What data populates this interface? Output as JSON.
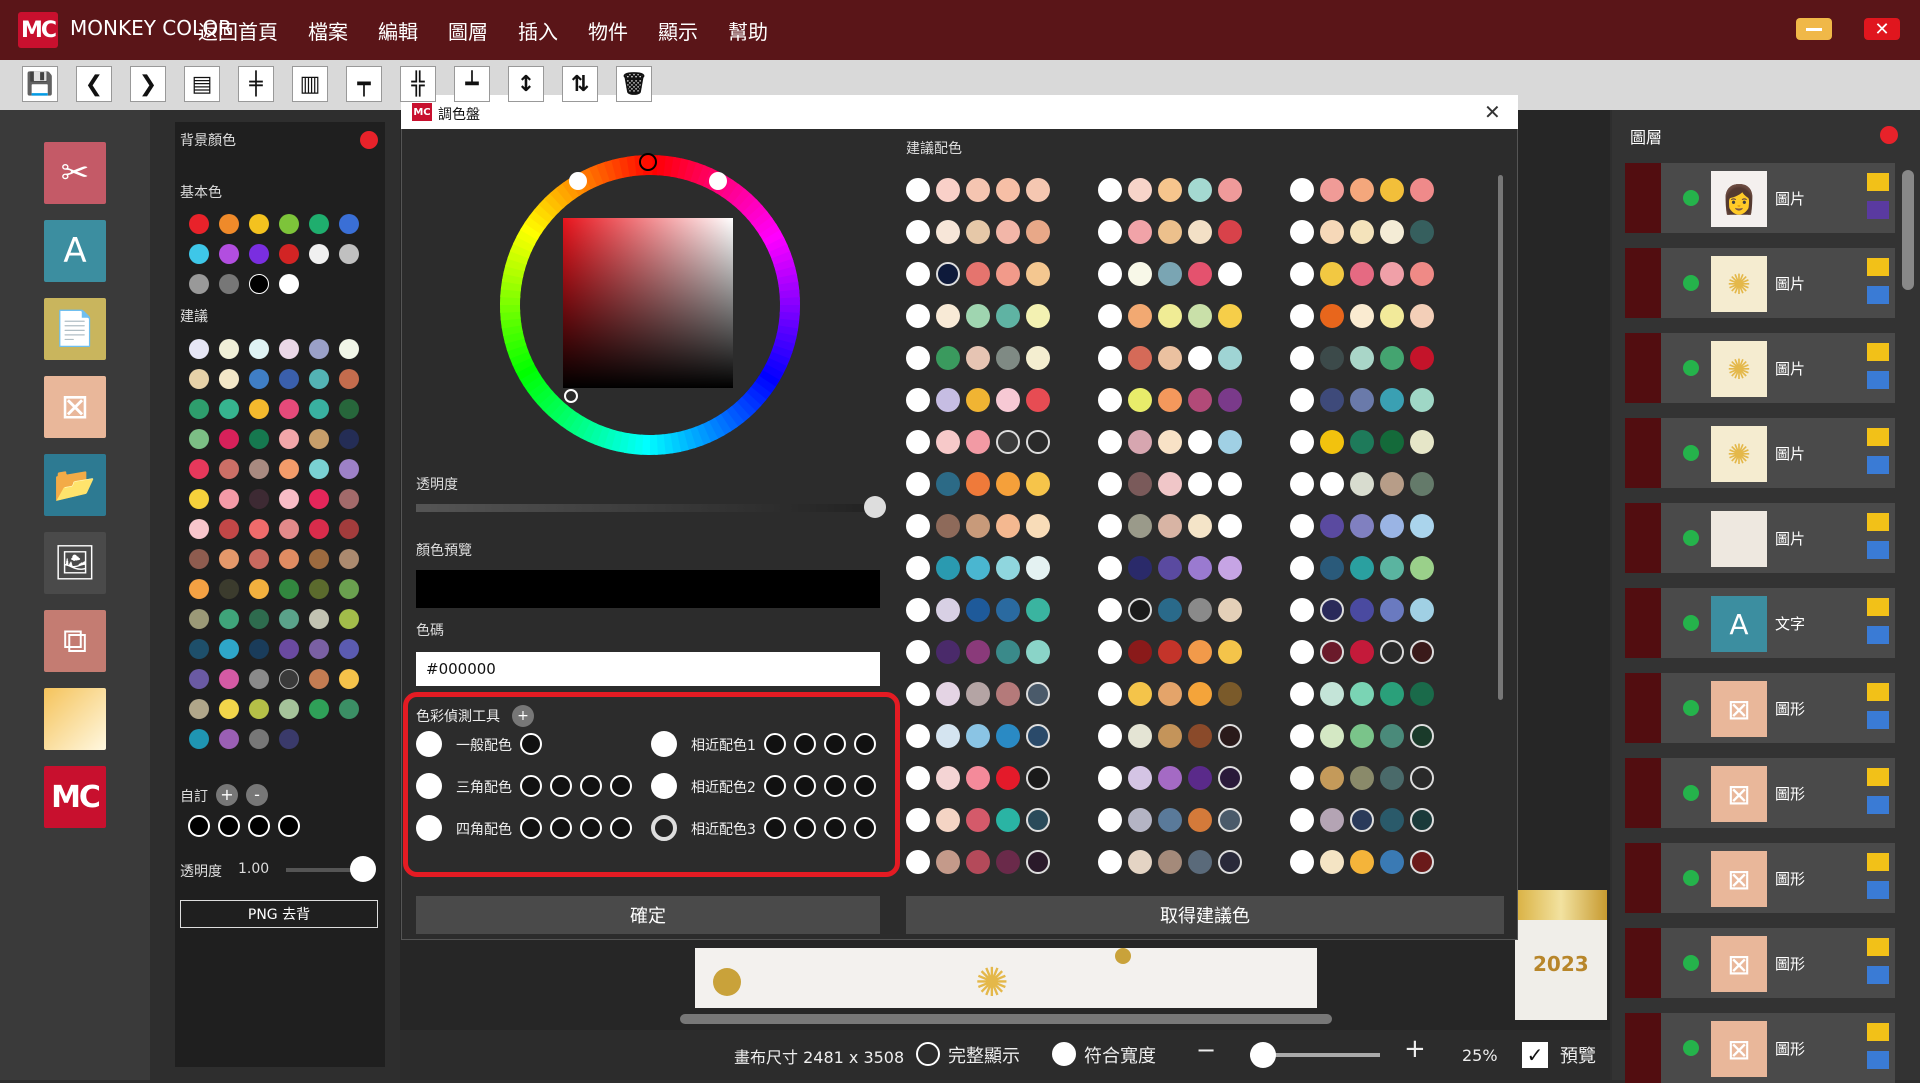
{
  "app": {
    "name": "MONKEY COLOR",
    "logo": "MC"
  },
  "menu": [
    "返回首頁",
    "檔案",
    "編輯",
    "圖層",
    "插入",
    "物件",
    "顯示",
    "幫助"
  ],
  "toolbar_icons": [
    "save-icon",
    "back-icon",
    "forward-icon",
    "align-left-icon",
    "align-center-icon",
    "align-right-icon",
    "align-top-icon",
    "align-middle-icon",
    "align-bottom-icon",
    "distribute-icon",
    "flip-icon",
    "trash-icon"
  ],
  "toolbar_glyphs": [
    "💾",
    "❮",
    "❯",
    "▤",
    "╪",
    "▥",
    "┯",
    "╬",
    "┷",
    "↕",
    "⇅",
    "🗑"
  ],
  "tools": [
    {
      "name": "cut-icon",
      "glyph": "✂",
      "bg": "#c45a67"
    },
    {
      "name": "text-icon",
      "glyph": "A",
      "bg": "#3c8ea0"
    },
    {
      "name": "document-icon",
      "glyph": "📄",
      "bg": "#c9b55d"
    },
    {
      "name": "shapes-icon",
      "glyph": "⊠",
      "bg": "#e9b79a"
    },
    {
      "name": "folder-open-icon",
      "glyph": "📂",
      "bg": "#2d7a92"
    },
    {
      "name": "image-icon",
      "glyph": "🖼",
      "bg": "#4a4a4a"
    },
    {
      "name": "crop-icon",
      "glyph": "⧉",
      "bg": "#c47c72"
    },
    {
      "name": "gradient-icon",
      "glyph": "",
      "bg": "#f5c35b"
    },
    {
      "name": "mc-logo-icon",
      "glyph": "MC",
      "bg": "#c8102e"
    }
  ],
  "colorpanel": {
    "bg_label": "背景顏色",
    "basic_label": "基本色",
    "suggest_label": "建議",
    "custom_label": "自訂",
    "alpha_label": "透明度",
    "alpha_value": "1.00",
    "png_button": "PNG 去背",
    "basic_colors": [
      "#e8222a",
      "#ef8a2a",
      "#f3c21f",
      "#7dc43a",
      "#1fae6e",
      "#3a6fd6",
      "#3ec7e8",
      "#b24ee0",
      "#7a2ee0",
      "#d22424",
      "#f0f0f0",
      "#c0c0c0",
      "#999999",
      "#777777",
      "#000000",
      "#ffffff"
    ],
    "suggest_colors": [
      "#e6e6f5",
      "#f0efd8",
      "#dff3f4",
      "#ead8e7",
      "#9aa0c8",
      "#f1f6e8",
      "#e6d1a8",
      "#f3e7c8",
      "#3f7ec5",
      "#3a5fab",
      "#53b3b4",
      "#c46c4d",
      "#2e9e6d",
      "#36b48f",
      "#f4b92d",
      "#e54a7a",
      "#39b0a0",
      "#27663b",
      "#7cbf85",
      "#d7215a",
      "#16784f",
      "#f2a6a9",
      "#c79e6a",
      "#242d55",
      "#e6385b",
      "#cc6f66",
      "#a88a80",
      "#f39c6a",
      "#7ad1d3",
      "#9d81c7",
      "#f6d13b",
      "#f49aa7",
      "#3d2a33",
      "#f8bcc6",
      "#e4265a",
      "#a26a6a",
      "#f8c6cc",
      "#c24747",
      "#ef6b6b",
      "#e38a8a",
      "#d92c4b",
      "#a23c3c",
      "#8e5c4f",
      "#e4986a",
      "#c8695f",
      "#e08c62",
      "#9c6a3f",
      "#ab8a6f",
      "#f4a143",
      "#3b3b2d",
      "#f2b03e",
      "#32873f",
      "#5b6a2d",
      "#6aa04f",
      "#9b9977",
      "#3fa47a",
      "#2e6b4e",
      "#5aa28a",
      "#c2c3b2",
      "#a2bc4a",
      "#1e4f6a",
      "#2ea6c9",
      "#1a3c5a",
      "#6a4aa0",
      "#7a60a3",
      "#5b5bb0",
      "#6a5aa3",
      "#d45aa4",
      "#8a8a8a",
      "#3a3a3a",
      "#c47c52",
      "#f5c24a",
      "#b0a68a",
      "#f2d54a",
      "#b5c047",
      "#a5c39a",
      "#2fa058",
      "#3b8f65",
      "#1f95b2",
      "#9a5fb4",
      "#777777",
      "#3a3a6a"
    ],
    "custom_colors": [
      "#000000",
      "#000000",
      "#000000",
      "#000000"
    ]
  },
  "dialog": {
    "title": "調色盤",
    "alpha_label": "透明度",
    "preview_label": "顏色預覽",
    "hex_label": "色碼",
    "hex_value": "#000000",
    "suggest_header": "建議配色",
    "tool_title": "色彩偵測工具",
    "options_left": [
      "一般配色",
      "三角配色",
      "四角配色"
    ],
    "options_right": [
      "相近配色1",
      "相近配色2",
      "相近配色3"
    ],
    "confirm_button": "確定",
    "get_suggest_button": "取得建議色",
    "palette_rows": [
      [
        "#ffffff",
        "#f9d0c8",
        "#f5c5b1",
        "#f7bfa6",
        "#f5c7b1",
        "#ffffff",
        "#f7d4c9",
        "#f6c58d",
        "#a4d9d1",
        "#ef9a9a",
        "#ffffff",
        "#f09b97",
        "#f4a77c",
        "#f2bf3a",
        "#ef8a8a"
      ],
      [
        "#ffffff",
        "#f7e6d8",
        "#e6c8a8",
        "#f2b6a8",
        "#e8a888",
        "#ffffff",
        "#f1a3a8",
        "#ecc08c",
        "#f3e0c6",
        "#d8424a",
        "#ffffff",
        "#f6d8b8",
        "#f4e3bb",
        "#f4ecd6",
        "#365f5e"
      ],
      [
        "#ffffff",
        "#0e1a3b",
        "#e5746e",
        "#f29a8a",
        "#f4c790",
        "#ffffff",
        "#f8f8e8",
        "#7aa5b3",
        "#e4526e",
        "#ffffff",
        "#ffffff",
        "#f2c842",
        "#e56a82",
        "#f0a0a8",
        "#ef8a86"
      ],
      [
        "#ffffff",
        "#f8ead6",
        "#9fd5b0",
        "#5fb3a3",
        "#f3f1b2",
        "#ffffff",
        "#f2a972",
        "#f0ec95",
        "#c9e0a9",
        "#f6ce49",
        "#ffffff",
        "#e8661c",
        "#faebd1",
        "#f2ea9a",
        "#f3cfb8"
      ],
      [
        "#ffffff",
        "#3a9a5e",
        "#e6c4b3",
        "#7f8a84",
        "#f4eed0",
        "#ffffff",
        "#d56a58",
        "#ebc1a0",
        "#ffffff",
        "#9fd4d4",
        "#ffffff",
        "#3c4a4a",
        "#a9d6c8",
        "#44a470",
        "#c4142a"
      ],
      [
        "#ffffff",
        "#c6bde3",
        "#f0b433",
        "#f7c9d4",
        "#e74c53",
        "#ffffff",
        "#e8ec6a",
        "#f4985c",
        "#b24a78",
        "#7a3a8a",
        "#ffffff",
        "#3e4a7a",
        "#6a7aaa",
        "#3aa0b3",
        "#9fd7c6"
      ],
      [
        "#ffffff",
        "#f7c9c9",
        "#f29aa4",
        "#3a3a3a",
        "#2a2a2a",
        "#ffffff",
        "#d7a6b0",
        "#f8e2c6",
        "#ffffff",
        "#a0d0e4",
        "#ffffff",
        "#f2c20e",
        "#1e7a5a",
        "#146a3a",
        "#e6e6c8"
      ],
      [
        "#ffffff",
        "#2c6a86",
        "#ef7a3a",
        "#f5a03a",
        "#f6c44a",
        "#ffffff",
        "#7a5a5a",
        "#f0c6c8",
        "#ffffff",
        "#ffffff",
        "#ffffff",
        "#ffffff",
        "#d8dccf",
        "#b79d88",
        "#647a6a"
      ],
      [
        "#ffffff",
        "#8e6a5a",
        "#c89a7a",
        "#f4b890",
        "#f8dcb8",
        "#ffffff",
        "#9a9a8a",
        "#d8b4a4",
        "#f4e4c8",
        "#ffffff",
        "#ffffff",
        "#5a4aa0",
        "#8080c0",
        "#9ab4e4",
        "#aad4ec"
      ],
      [
        "#ffffff",
        "#2a9ab0",
        "#4ab6d0",
        "#8fd6de",
        "#e4f2f2",
        "#ffffff",
        "#2a2a6a",
        "#5a4aa0",
        "#9a7ad0",
        "#c6a4e4",
        "#ffffff",
        "#2a5a7a",
        "#2aa0a0",
        "#5ab4a0",
        "#9ad08a"
      ],
      [
        "#ffffff",
        "#d8d0e4",
        "#1e5a9a",
        "#2a6aa0",
        "#3ab4a0",
        "#ffffff",
        "#1a1a1a",
        "#2a6a8a",
        "#8a8a8a",
        "#e4d0b8",
        "#ffffff",
        "#2a2a5a",
        "#4a4aa0",
        "#6a7ac0",
        "#a0d0e4"
      ],
      [
        "#ffffff",
        "#4a2a6a",
        "#8a3a7a",
        "#3a8a8a",
        "#8ad4c8",
        "#ffffff",
        "#8a1a1a",
        "#c4342a",
        "#f29a4a",
        "#f4c44a",
        "#ffffff",
        "#6a1a2a",
        "#c41a3a",
        "#2a2a2a",
        "#3a1a1a"
      ],
      [
        "#ffffff",
        "#e4d4e4",
        "#b4a4a4",
        "#b47a7a",
        "#4a5a6a",
        "#ffffff",
        "#f4c44a",
        "#e4a46a",
        "#f4a43a",
        "#7a5a2a",
        "#ffffff",
        "#c4e4d8",
        "#7ad4b4",
        "#2aa07a",
        "#1a6a4a"
      ],
      [
        "#ffffff",
        "#d4e4f0",
        "#8ac4e4",
        "#2a8ac4",
        "#2a4a6a",
        "#ffffff",
        "#e4e4d4",
        "#c4945a",
        "#8a4a2a",
        "#2a1a1a",
        "#ffffff",
        "#d4e8c4",
        "#7ac48a",
        "#4a8a7a",
        "#1a3a2a"
      ],
      [
        "#ffffff",
        "#f4d4d4",
        "#f48a9a",
        "#e41a2a",
        "#1a1a1a",
        "#ffffff",
        "#d4c4e4",
        "#a46ac4",
        "#5a2a8a",
        "#2a1a3a",
        "#ffffff",
        "#c49a5a",
        "#8a8a6a",
        "#4a6a6a",
        "#2a2a2a"
      ],
      [
        "#ffffff",
        "#f4d4c4",
        "#d45a6a",
        "#2ab4a4",
        "#2a4a5a",
        "#ffffff",
        "#b4b4c4",
        "#5a7a9a",
        "#d47a3a",
        "#4a5a6a",
        "#ffffff",
        "#b4a4b4",
        "#2a3a5a",
        "#2a5a6a",
        "#1a3a3a"
      ],
      [
        "#ffffff",
        "#c49a8a",
        "#b44a5a",
        "#6a2a4a",
        "#2a1a2a",
        "#ffffff",
        "#e4d4c4",
        "#a48a7a",
        "#5a6a7a",
        "#2a2a3a",
        "#ffffff",
        "#f4e4c4",
        "#f4b43a",
        "#3a7ab4",
        "#6a1a1a"
      ]
    ]
  },
  "status": {
    "canvas_size": "畫布尺寸 2481 x 3508",
    "fit_all": "完整顯示",
    "fit_width": "符合寬度",
    "minus": "−",
    "plus": "+",
    "zoom": "25%",
    "preview": "預覽"
  },
  "doc_thumb_text": "2023",
  "layers": {
    "title": "圖層",
    "items": [
      {
        "name": "圖片",
        "thumb": "👩",
        "thumb_bg": "#f4f0ee"
      },
      {
        "name": "圖片",
        "thumb": "✺",
        "thumb_bg": "#f5ecd0"
      },
      {
        "name": "圖片",
        "thumb": "✺",
        "thumb_bg": "#f5ecd0"
      },
      {
        "name": "圖片",
        "thumb": "✺",
        "thumb_bg": "#f5ecd0"
      },
      {
        "name": "圖片",
        "thumb": "",
        "thumb_bg": "#eee8e0"
      },
      {
        "name": "文字",
        "thumb": "A",
        "thumb_bg": "#3c8ea0"
      },
      {
        "name": "圖形",
        "thumb": "⊠",
        "thumb_bg": "#e9b79a"
      },
      {
        "name": "圖形",
        "thumb": "⊠",
        "thumb_bg": "#e9b79a"
      },
      {
        "name": "圖形",
        "thumb": "⊠",
        "thumb_bg": "#e9b79a"
      },
      {
        "name": "圖形",
        "thumb": "⊠",
        "thumb_bg": "#e9b79a"
      },
      {
        "name": "圖形",
        "thumb": "⊠",
        "thumb_bg": "#e9b79a"
      }
    ]
  }
}
